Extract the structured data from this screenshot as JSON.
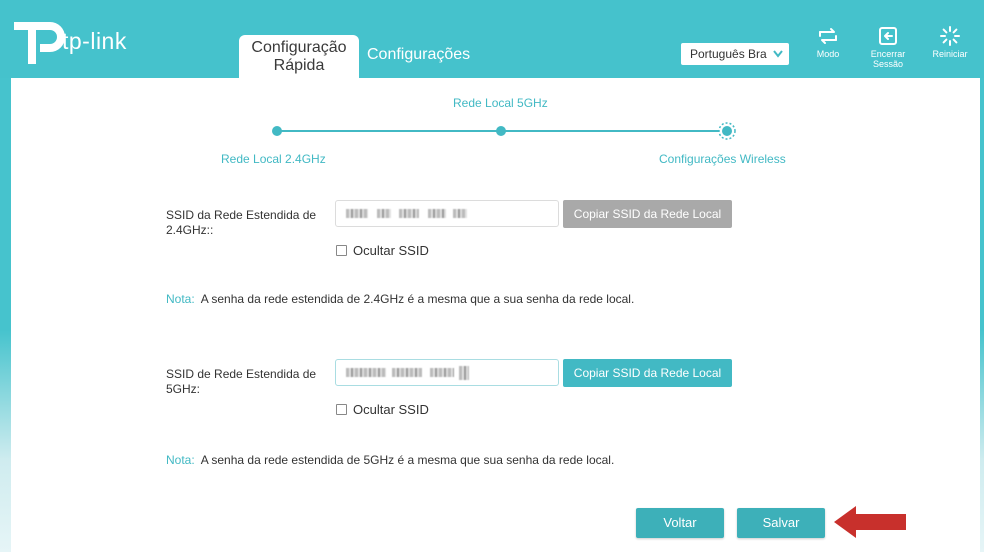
{
  "brand": {
    "name": "tp-link"
  },
  "tabs": {
    "quick_setup": "Configuração\nRápida",
    "settings": "Configurações"
  },
  "language": {
    "selected": "Português Bra"
  },
  "top_actions": {
    "mode": "Modo",
    "logout": "Encerrar Sessão",
    "reboot": "Reiniciar"
  },
  "steps": {
    "step1": "Rede Local 2.4GHz",
    "step2": "Rede Local 5GHz",
    "step3": "Configurações Wireless",
    "current_step": 3
  },
  "band_24": {
    "label": "SSID da Rede Estendida de 2.4GHz::",
    "copy_button": "Copiar SSID da Rede Local",
    "hide_label": "Ocultar SSID",
    "hide_checked": false,
    "note_label": "Nota:",
    "note_text": "A senha da rede estendida de 2.4GHz é a mesma que a sua senha da rede local."
  },
  "band_5": {
    "label": "SSID de Rede Estendida de 5GHz:",
    "copy_button": "Copiar SSID da Rede Local",
    "hide_label": "Ocultar SSID",
    "hide_checked": false,
    "note_label": "Nota:",
    "note_text": "A senha da rede estendida de 5GHz é a mesma que sua senha da rede local."
  },
  "buttons": {
    "back": "Voltar",
    "save": "Salvar"
  },
  "colors": {
    "accent": "#45c2cc",
    "button": "#3db0b9",
    "disabled_button": "#a9a9a9",
    "annotation_arrow": "#c8302c"
  }
}
